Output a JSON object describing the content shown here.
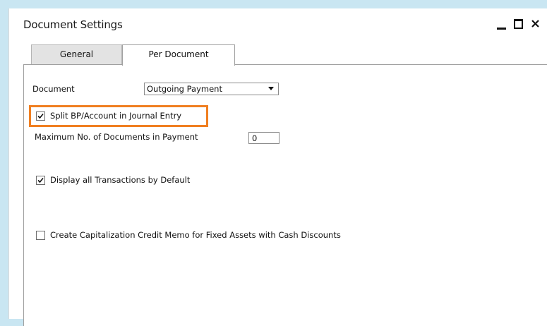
{
  "window": {
    "title": "Document Settings"
  },
  "tabs": [
    {
      "label": "General",
      "active": false
    },
    {
      "label": "Per Document",
      "active": true
    }
  ],
  "form": {
    "document_label": "Document",
    "document_value": "Outgoing Payment",
    "split_label": "Split BP/Account in Journal Entry",
    "split_checked": true,
    "max_docs_label": "Maximum No. of Documents in Payment",
    "max_docs_value": "0",
    "display_all_label": "Display all Transactions by Default",
    "display_all_checked": true,
    "capitalization_label": "Create Capitalization Credit Memo for Fixed Assets with Cash Discounts",
    "capitalization_checked": false
  },
  "colors": {
    "highlight": "#f07f21",
    "background": "#c9e6f2"
  }
}
